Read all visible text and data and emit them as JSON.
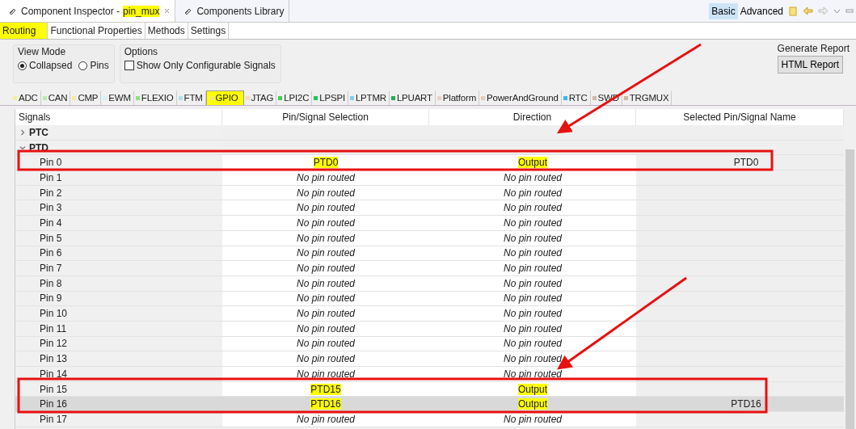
{
  "view_tabs": [
    {
      "label": "Component Inspector -",
      "document": "pin_mux",
      "document_highlighted": true,
      "closable": true,
      "selected": true
    },
    {
      "label": "Components Library",
      "closable": false,
      "selected": false
    }
  ],
  "mode_buttons": [
    {
      "label": "Basic",
      "selected": true
    },
    {
      "label": "Advanced",
      "selected": false
    }
  ],
  "sub_tabs": [
    {
      "label": "Routing",
      "selected": true,
      "highlighted": true
    },
    {
      "label": "Functional Properties",
      "selected": false,
      "highlighted": false
    },
    {
      "label": "Methods",
      "selected": false,
      "highlighted": false
    },
    {
      "label": "Settings",
      "selected": false,
      "highlighted": false
    }
  ],
  "view_mode": {
    "title": "View Mode",
    "options": [
      {
        "label": "Collapsed",
        "selected": true
      },
      {
        "label": "Pins",
        "selected": false
      }
    ]
  },
  "options": {
    "title": "Options",
    "checkbox": {
      "label": "Show Only Configurable Signals",
      "checked": false
    }
  },
  "generate_report": {
    "title": "Generate Report",
    "button": "HTML Report"
  },
  "categories": [
    {
      "label": "ADC",
      "color": "#f3ef9c",
      "selected": false,
      "highlighted": false
    },
    {
      "label": "CAN",
      "color": "#b5efaa",
      "selected": false,
      "highlighted": false
    },
    {
      "label": "CMP",
      "color": "#f3ec9c",
      "selected": false,
      "highlighted": false
    },
    {
      "label": "EWM",
      "color": "#d4f1f5",
      "selected": false,
      "highlighted": false
    },
    {
      "label": "FLEXIO",
      "color": "#8fe07e",
      "selected": false,
      "highlighted": false
    },
    {
      "label": "FTM",
      "color": "#b3e0f1",
      "selected": false,
      "highlighted": false
    },
    {
      "label": "GPIO",
      "color": "#f5e870",
      "selected": true,
      "highlighted": true
    },
    {
      "label": "JTAG",
      "color": "#f6dcc0",
      "selected": false,
      "highlighted": false
    },
    {
      "label": "LPI2C",
      "color": "#3fd14a",
      "selected": false,
      "highlighted": false
    },
    {
      "label": "LPSPI",
      "color": "#1fc55e",
      "selected": false,
      "highlighted": false
    },
    {
      "label": "LPTMR",
      "color": "#7fd0f2",
      "selected": false,
      "highlighted": false
    },
    {
      "label": "LPUART",
      "color": "#1fae4f",
      "selected": false,
      "highlighted": false
    },
    {
      "label": "Platform",
      "color": "#ead2c4",
      "selected": false,
      "highlighted": false
    },
    {
      "label": "PowerAndGround",
      "color": "#e3cbbb",
      "selected": false,
      "highlighted": false
    },
    {
      "label": "RTC",
      "color": "#3db6f1",
      "selected": false,
      "highlighted": false
    },
    {
      "label": "SWD",
      "color": "#cbb9a3",
      "selected": false,
      "highlighted": false
    },
    {
      "label": "TRGMUX",
      "color": "#cbb9a3",
      "selected": false,
      "highlighted": false
    }
  ],
  "table": {
    "columns": [
      "Signals",
      "Pin/Signal Selection",
      "Direction",
      "Selected Pin/Signal Name"
    ],
    "groups": [
      {
        "name": "PTC",
        "expanded": false
      },
      {
        "name": "PTD",
        "expanded": true,
        "children": [
          {
            "signal": "Pin 0",
            "selection": "PTD0",
            "direction": "Output",
            "name": "PTD0",
            "routed": true,
            "highlighted": true,
            "selected": false
          },
          {
            "signal": "Pin 1",
            "selection": "No pin routed",
            "direction": "No pin routed",
            "routed": false,
            "highlighted": false,
            "selected": false
          },
          {
            "signal": "Pin 2",
            "selection": "No pin routed",
            "direction": "No pin routed",
            "routed": false,
            "highlighted": false,
            "selected": false
          },
          {
            "signal": "Pin 3",
            "selection": "No pin routed",
            "direction": "No pin routed",
            "routed": false,
            "highlighted": false,
            "selected": false
          },
          {
            "signal": "Pin 4",
            "selection": "No pin routed",
            "direction": "No pin routed",
            "routed": false,
            "highlighted": false,
            "selected": false
          },
          {
            "signal": "Pin 5",
            "selection": "No pin routed",
            "direction": "No pin routed",
            "routed": false,
            "highlighted": false,
            "selected": false
          },
          {
            "signal": "Pin 6",
            "selection": "No pin routed",
            "direction": "No pin routed",
            "routed": false,
            "highlighted": false,
            "selected": false
          },
          {
            "signal": "Pin 7",
            "selection": "No pin routed",
            "direction": "No pin routed",
            "routed": false,
            "highlighted": false,
            "selected": false
          },
          {
            "signal": "Pin 8",
            "selection": "No pin routed",
            "direction": "No pin routed",
            "routed": false,
            "highlighted": false,
            "selected": false
          },
          {
            "signal": "Pin 9",
            "selection": "No pin routed",
            "direction": "No pin routed",
            "routed": false,
            "highlighted": false,
            "selected": false
          },
          {
            "signal": "Pin 10",
            "selection": "No pin routed",
            "direction": "No pin routed",
            "routed": false,
            "highlighted": false,
            "selected": false
          },
          {
            "signal": "Pin 11",
            "selection": "No pin routed",
            "direction": "No pin routed",
            "routed": false,
            "highlighted": false,
            "selected": false
          },
          {
            "signal": "Pin 12",
            "selection": "No pin routed",
            "direction": "No pin routed",
            "routed": false,
            "highlighted": false,
            "selected": false
          },
          {
            "signal": "Pin 13",
            "selection": "No pin routed",
            "direction": "No pin routed",
            "routed": false,
            "highlighted": false,
            "selected": false
          },
          {
            "signal": "Pin 14",
            "selection": "No pin routed",
            "direction": "No pin routed",
            "routed": false,
            "highlighted": false,
            "selected": false
          },
          {
            "signal": "Pin 15",
            "selection": "PTD15",
            "direction": "Output",
            "routed": true,
            "highlighted": true,
            "selected": false
          },
          {
            "signal": "Pin 16",
            "selection": "PTD16",
            "direction": "Output",
            "name": "PTD16",
            "routed": true,
            "highlighted": true,
            "selected": true
          },
          {
            "signal": "Pin 17",
            "selection": "No pin routed",
            "direction": "No pin routed",
            "routed": false,
            "highlighted": false,
            "selected": false
          }
        ]
      }
    ]
  }
}
